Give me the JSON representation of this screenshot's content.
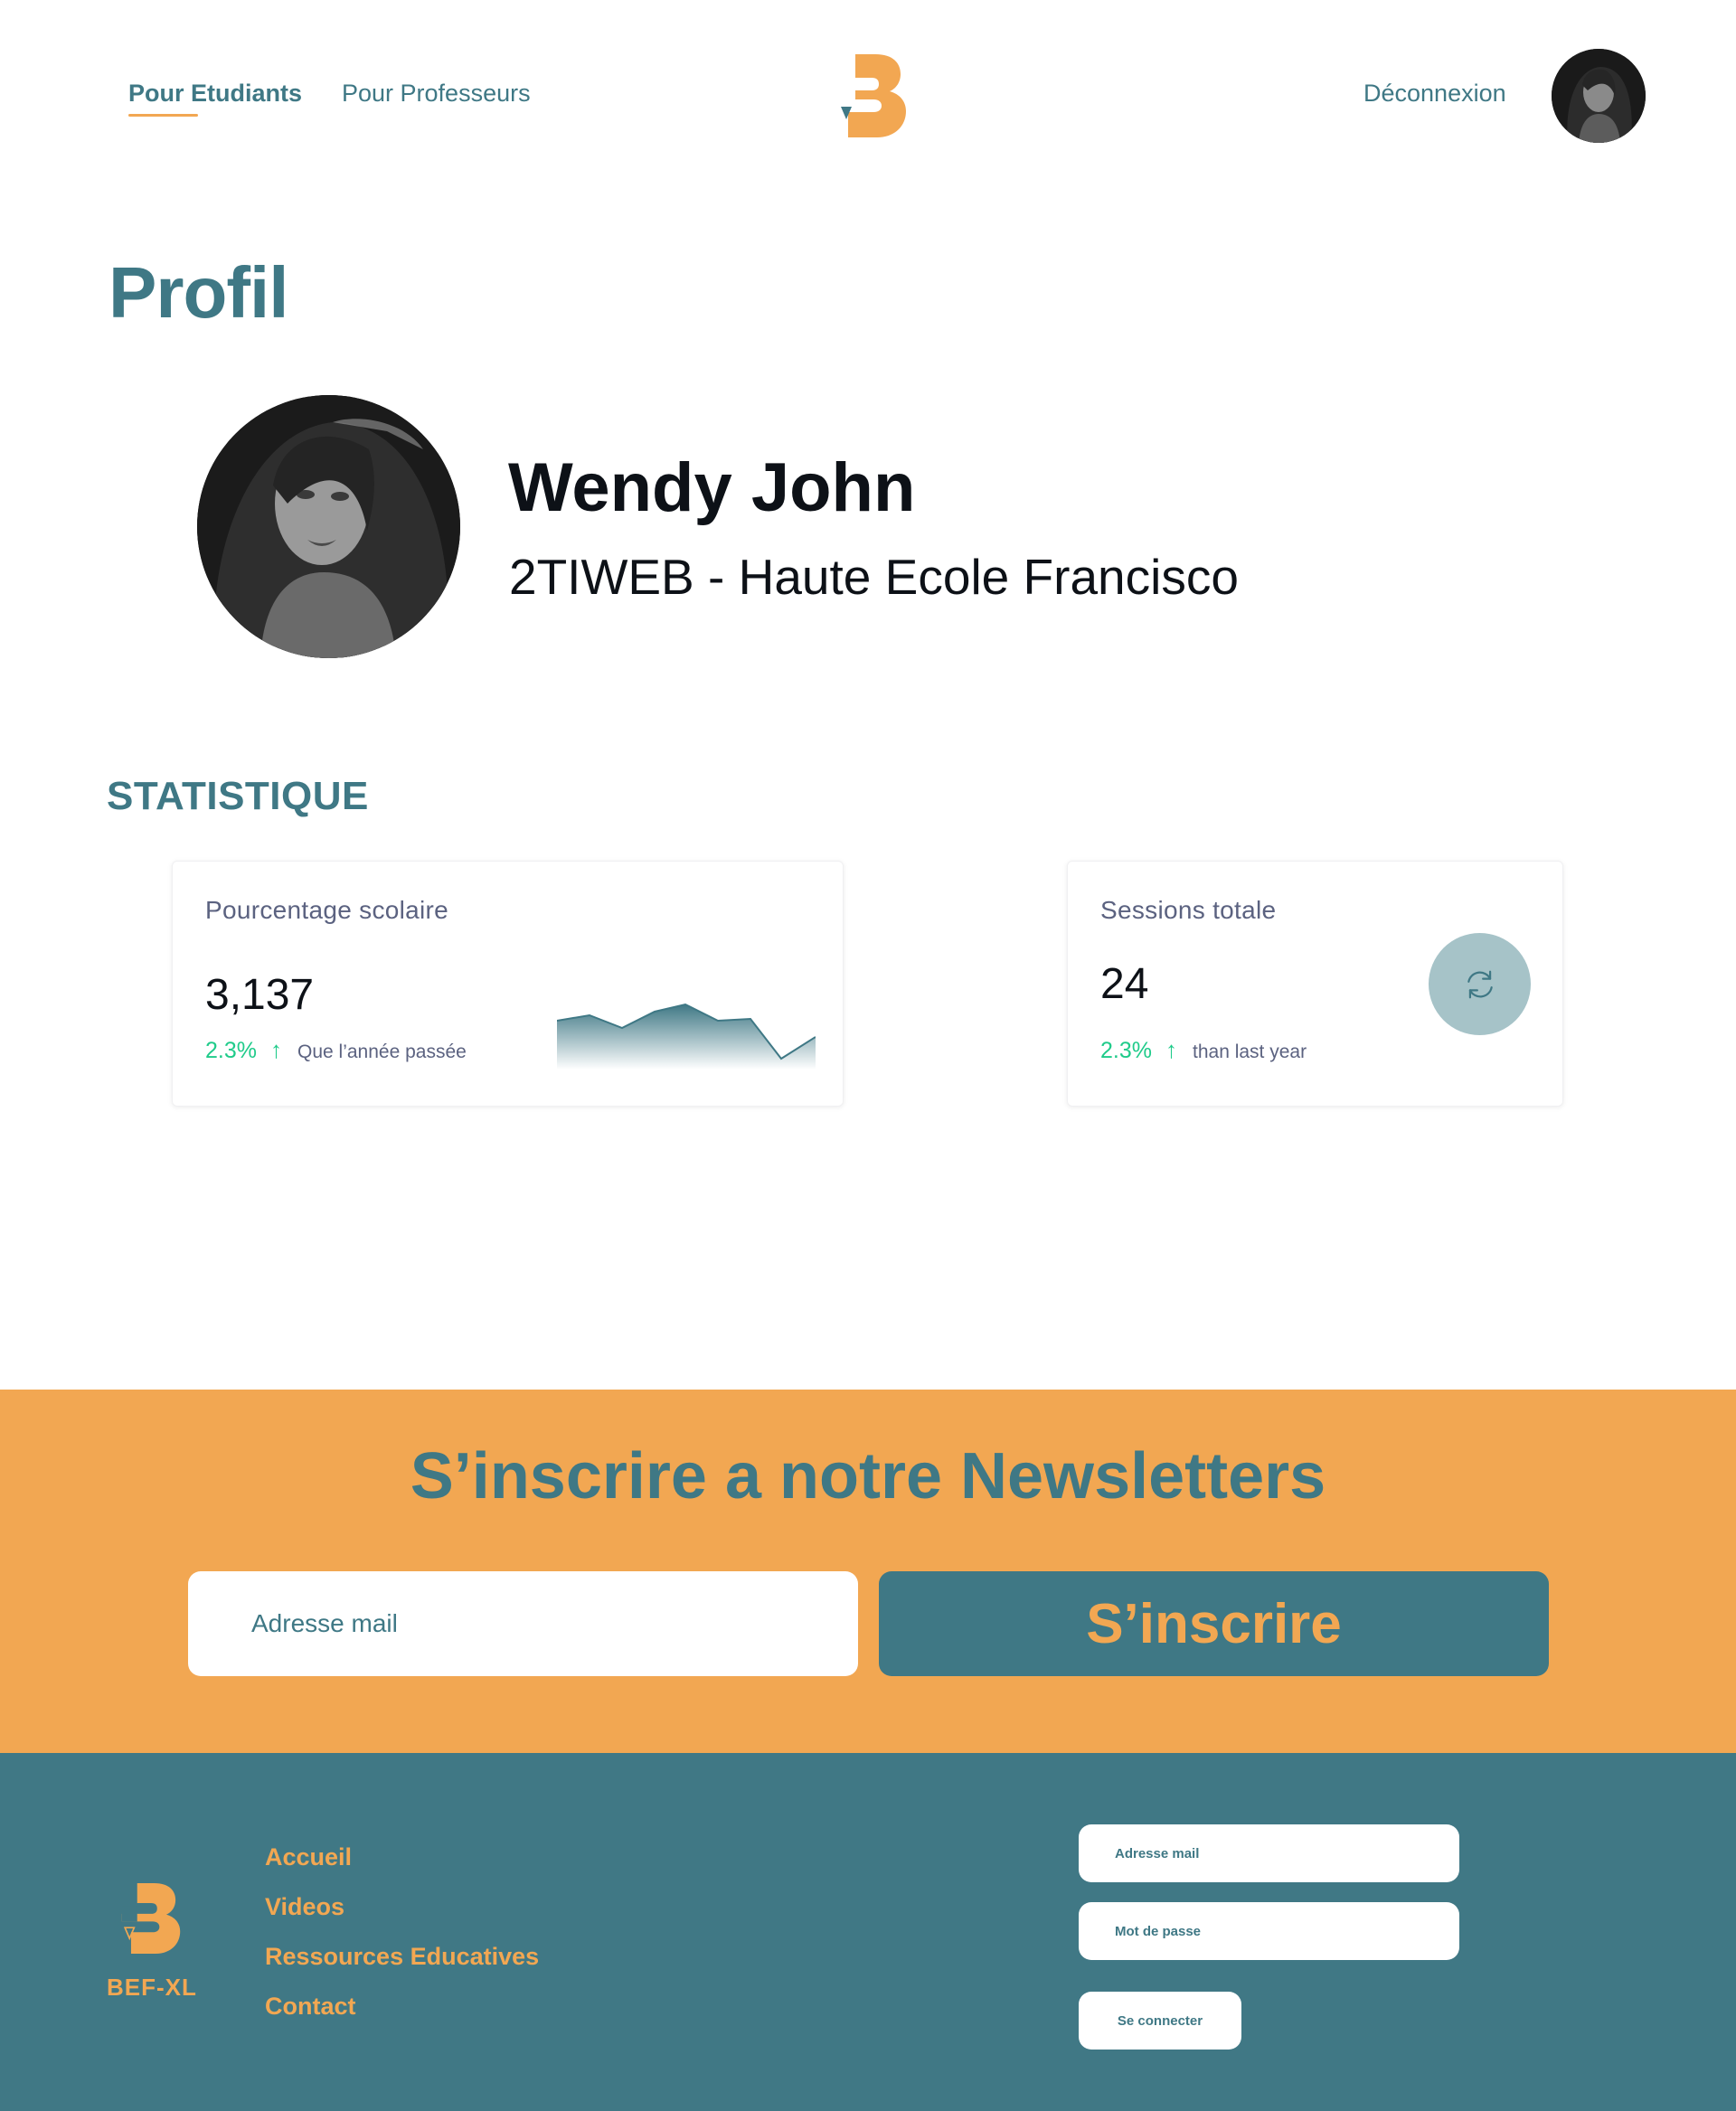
{
  "header": {
    "nav": [
      {
        "label": "Pour Etudiants",
        "active": true
      },
      {
        "label": "Pour Professeurs",
        "active": false
      }
    ],
    "logout_label": "Déconnexion"
  },
  "profile": {
    "page_title": "Profil",
    "name": "Wendy John",
    "subtitle": "2TIWEB - Haute Ecole Francisco"
  },
  "statistics": {
    "section_title": "STATISTIQUE",
    "cards": [
      {
        "label": "Pourcentage scolaire",
        "value": "3,137",
        "delta": "2.3%",
        "delta_direction": "up",
        "note": "Que l’année passée",
        "sparkline_icon": "area-sparkline"
      },
      {
        "label": "Sessions totale",
        "value": "24",
        "delta": "2.3%",
        "delta_direction": "up",
        "note": "than last year",
        "action_icon": "refresh-icon"
      }
    ]
  },
  "newsletter": {
    "title": "S’inscrire a notre Newsletters",
    "email_placeholder": "Adresse mail",
    "submit_label": "S’inscrire"
  },
  "footer": {
    "brand": "BEF-XL",
    "links": [
      "Accueil",
      "Videos",
      "Ressources Educatives",
      "Contact"
    ],
    "login": {
      "email_placeholder": "Adresse mail",
      "password_placeholder": "Mot de passe",
      "submit_label": "Se connecter"
    }
  },
  "colors": {
    "primary": "#3f7885",
    "accent": "#f2a752",
    "positive": "#1fcb8a",
    "muted_text": "#5b6280"
  }
}
